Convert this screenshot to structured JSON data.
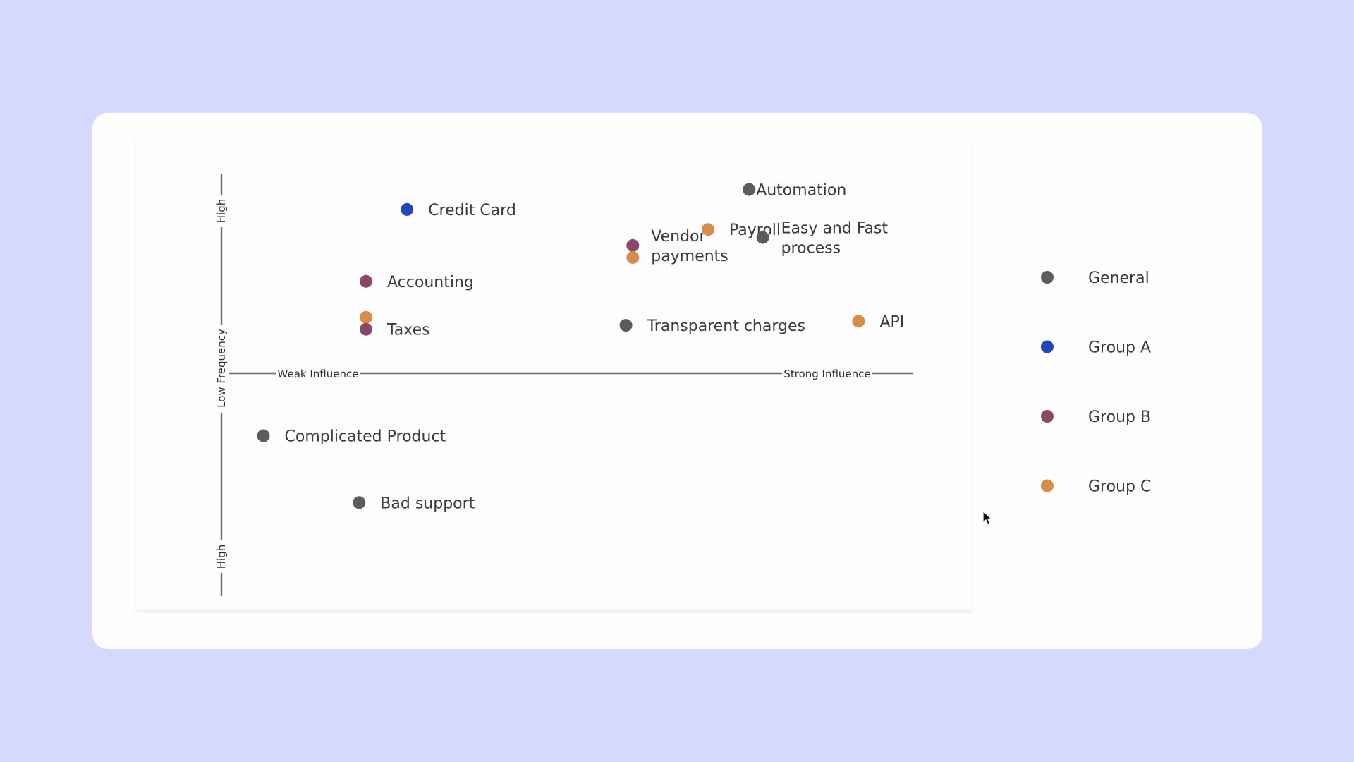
{
  "chart_data": {
    "type": "scatter",
    "title": "",
    "xlabel_left": "Weak Influence",
    "xlabel_right": "Strong Influence",
    "ylabel_center": "Low Frequency",
    "ylabel_top": "High",
    "ylabel_bottom": "High",
    "xlim": [
      0,
      10
    ],
    "ylim": [
      -5,
      5
    ],
    "grid": false,
    "legend_position": "right",
    "groups": [
      {
        "name": "General",
        "color": "#5c5c5f"
      },
      {
        "name": "Group A",
        "color": "#2346b8"
      },
      {
        "name": "Group B",
        "color": "#8a4766"
      },
      {
        "name": "Group C",
        "color": "#d58d48"
      }
    ],
    "points": [
      {
        "label": [
          "Credit Card"
        ],
        "group": "Group A",
        "x": 2.6,
        "y": 4.1
      },
      {
        "label": [
          "Automation"
        ],
        "group": "General",
        "x": 7.6,
        "y": 4.6
      },
      {
        "label": [
          "Vendor",
          "payments"
        ],
        "group": "Group B",
        "x": 5.9,
        "y": 3.2
      },
      {
        "label": [],
        "group": "Group C",
        "x": 5.9,
        "y": 2.9
      },
      {
        "label": [
          "Payroll"
        ],
        "group": "Group C",
        "x": 7.0,
        "y": 3.6
      },
      {
        "label": [
          "Easy and Fast",
          "process"
        ],
        "group": "General",
        "x": 7.8,
        "y": 3.4
      },
      {
        "label": [
          "Accounting"
        ],
        "group": "Group B",
        "x": 2.0,
        "y": 2.3
      },
      {
        "label": [],
        "group": "Group C",
        "x": 2.0,
        "y": 1.4
      },
      {
        "label": [
          "Taxes"
        ],
        "group": "Group B",
        "x": 2.0,
        "y": 1.1
      },
      {
        "label": [
          "Transparent charges"
        ],
        "group": "General",
        "x": 5.8,
        "y": 1.2
      },
      {
        "label": [
          "API"
        ],
        "group": "Group C",
        "x": 9.2,
        "y": 1.3
      },
      {
        "label": [
          "Complicated Product"
        ],
        "group": "General",
        "x": 0.5,
        "y": -1.4
      },
      {
        "label": [
          "Bad support"
        ],
        "group": "General",
        "x": 1.9,
        "y": -2.9
      }
    ]
  }
}
